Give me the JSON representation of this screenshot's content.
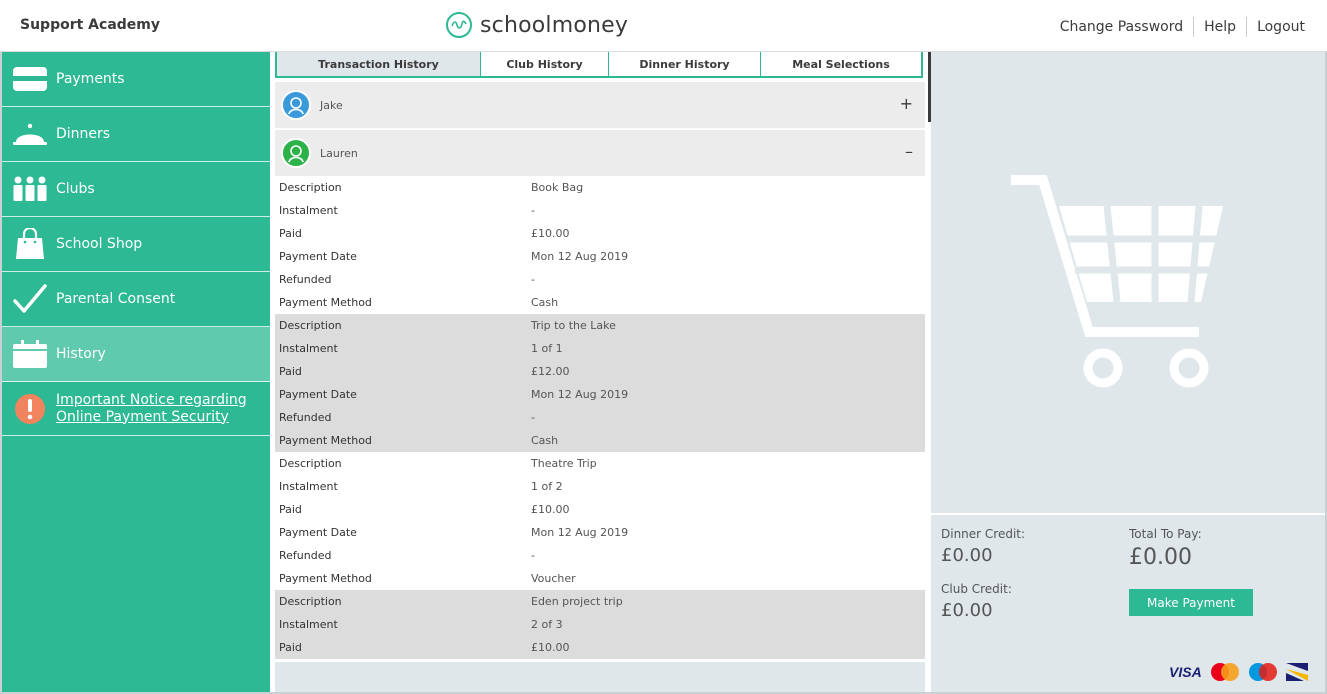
{
  "header": {
    "school_name": "Support Academy",
    "logo_text": "schoolmoney",
    "links": {
      "change_password": "Change Password",
      "help": "Help",
      "logout": "Logout"
    }
  },
  "sidebar": {
    "items": [
      {
        "label": "Payments",
        "icon": "card-icon"
      },
      {
        "label": "Dinners",
        "icon": "cloche-icon"
      },
      {
        "label": "Clubs",
        "icon": "people-icon"
      },
      {
        "label": "School Shop",
        "icon": "bag-icon"
      },
      {
        "label": "Parental Consent",
        "icon": "checkmark-icon"
      },
      {
        "label": "History",
        "icon": "calendar-icon",
        "active": true
      }
    ],
    "notice": {
      "line1": "Important Notice regarding",
      "line2": "Online Payment Security"
    }
  },
  "tabs": [
    {
      "label": "Transaction History",
      "active": true
    },
    {
      "label": "Club History"
    },
    {
      "label": "Dinner History"
    },
    {
      "label": "Meal Selections"
    }
  ],
  "children": [
    {
      "name": "Jake",
      "toggle": "+",
      "color": "#3a9ad9"
    },
    {
      "name": "Lauren",
      "toggle": "–",
      "color": "#2db24a"
    }
  ],
  "field_labels": {
    "description": "Description",
    "instalment": "Instalment",
    "paid": "Paid",
    "payment_date": "Payment Date",
    "refunded": "Refunded",
    "payment_method": "Payment Method"
  },
  "transactions": [
    {
      "description": "Book Bag",
      "instalment": "-",
      "paid": "£10.00",
      "payment_date": "Mon 12 Aug 2019",
      "refunded": "-",
      "payment_method": "Cash"
    },
    {
      "description": "Trip to the Lake",
      "instalment": "1 of 1",
      "paid": "£12.00",
      "payment_date": "Mon 12 Aug 2019",
      "refunded": "-",
      "payment_method": "Cash"
    },
    {
      "description": "Theatre Trip",
      "instalment": "1 of 2",
      "paid": "£10.00",
      "payment_date": "Mon 12 Aug 2019",
      "refunded": "-",
      "payment_method": "Voucher"
    },
    {
      "description": "Eden project trip",
      "instalment": "2 of 3",
      "paid": "£10.00"
    }
  ],
  "summary": {
    "dinner_credit_label": "Dinner Credit:",
    "dinner_credit_value": "£0.00",
    "club_credit_label": "Club Credit:",
    "club_credit_value": "£0.00",
    "total_label": "Total To Pay:",
    "total_value": "£0.00",
    "pay_button": "Make Payment"
  },
  "cards": {
    "visa": "VISA"
  },
  "colors": {
    "accent": "#2cb993",
    "active_item": "#5fcaad",
    "panel": "#dfe7ea"
  }
}
